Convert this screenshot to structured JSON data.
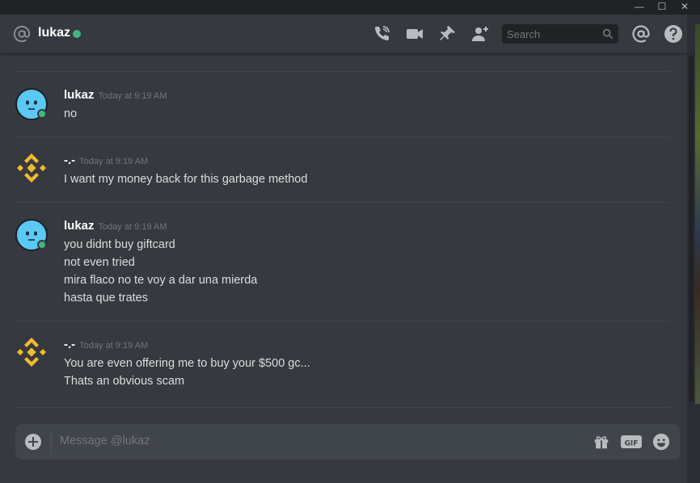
{
  "window": {
    "minimize_glyph": "—",
    "maximize_glyph": "☐",
    "close_glyph": "✕"
  },
  "header": {
    "channel_name": "lukaz",
    "status_color": "#43b581",
    "icons": [
      "call-icon",
      "video-icon",
      "pin-icon",
      "add-friend-icon",
      "mention-icon",
      "help-icon"
    ],
    "search_placeholder": "Search"
  },
  "messages": [
    {
      "author": "lukaz",
      "timestamp": "Today at 9:19 AM",
      "avatar": "blue-face-avatar",
      "lines": [
        "no"
      ]
    },
    {
      "author": "-.-",
      "timestamp": "Today at 9:19 AM",
      "avatar": "binance-logo-avatar",
      "lines": [
        "I want my money back for this garbage method"
      ]
    },
    {
      "author": "lukaz",
      "timestamp": "Today at 9:19 AM",
      "avatar": "blue-face-avatar",
      "lines": [
        "you didnt buy giftcard",
        "not even tried",
        "mira flaco no te voy a dar una mierda",
        "hasta que trates"
      ]
    },
    {
      "author": "-.-",
      "timestamp": "Today at 9:19 AM",
      "avatar": "binance-logo-avatar",
      "lines": [
        "You are even offering me to buy your $500 gc...",
        "Thats an obvious scam"
      ]
    }
  ],
  "composer": {
    "placeholder": "Message @lukaz",
    "icons": [
      "gift-icon",
      "gif-icon",
      "emoji-icon"
    ],
    "gif_label": "GIF"
  },
  "colors": {
    "background": "#36393f",
    "accent_yellow": "#f3ba2f",
    "avatar_blue": "#5bc8f5",
    "online": "#43b581"
  }
}
